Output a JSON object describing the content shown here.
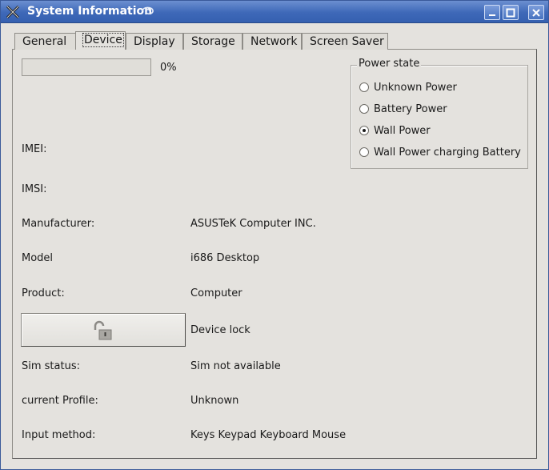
{
  "window": {
    "title": "System Information"
  },
  "tabs": [
    {
      "label": "General"
    },
    {
      "label": "Device"
    },
    {
      "label": "Display"
    },
    {
      "label": "Storage"
    },
    {
      "label": "Network"
    },
    {
      "label": "Screen Saver"
    }
  ],
  "active_tab": "Device",
  "battery": {
    "progress_percent": 0,
    "progress_text": "0%"
  },
  "power_state": {
    "title": "Power state",
    "options": [
      {
        "label": "Unknown Power",
        "checked": false
      },
      {
        "label": "Battery Power",
        "checked": false
      },
      {
        "label": "Wall Power",
        "checked": true
      },
      {
        "label": "Wall Power charging Battery",
        "checked": false
      }
    ]
  },
  "fields": {
    "imei": {
      "label": "IMEI:",
      "value": ""
    },
    "imsi": {
      "label": "IMSI:",
      "value": ""
    },
    "manufacturer": {
      "label": "Manufacturer:",
      "value": "ASUSTeK Computer INC."
    },
    "model": {
      "label": "Model",
      "value": "i686 Desktop"
    },
    "product": {
      "label": "Product:",
      "value": "Computer"
    },
    "device_lock": {
      "label": "Device lock"
    },
    "sim_status": {
      "label": "Sim status:",
      "value": "Sim not available"
    },
    "current_profile": {
      "label": "current Profile:",
      "value": "Unknown"
    },
    "input_method": {
      "label": "Input method:",
      "value": "Keys Keypad Keyboard Mouse"
    }
  },
  "icons": {
    "app": "kde-x-icon",
    "title_extra": "swirl-icon",
    "lock": "unlocked-padlock-icon"
  },
  "colors": {
    "titlebar": "#3e68b8",
    "window_bg": "#e4e2de",
    "title_text": "#ffffff"
  }
}
